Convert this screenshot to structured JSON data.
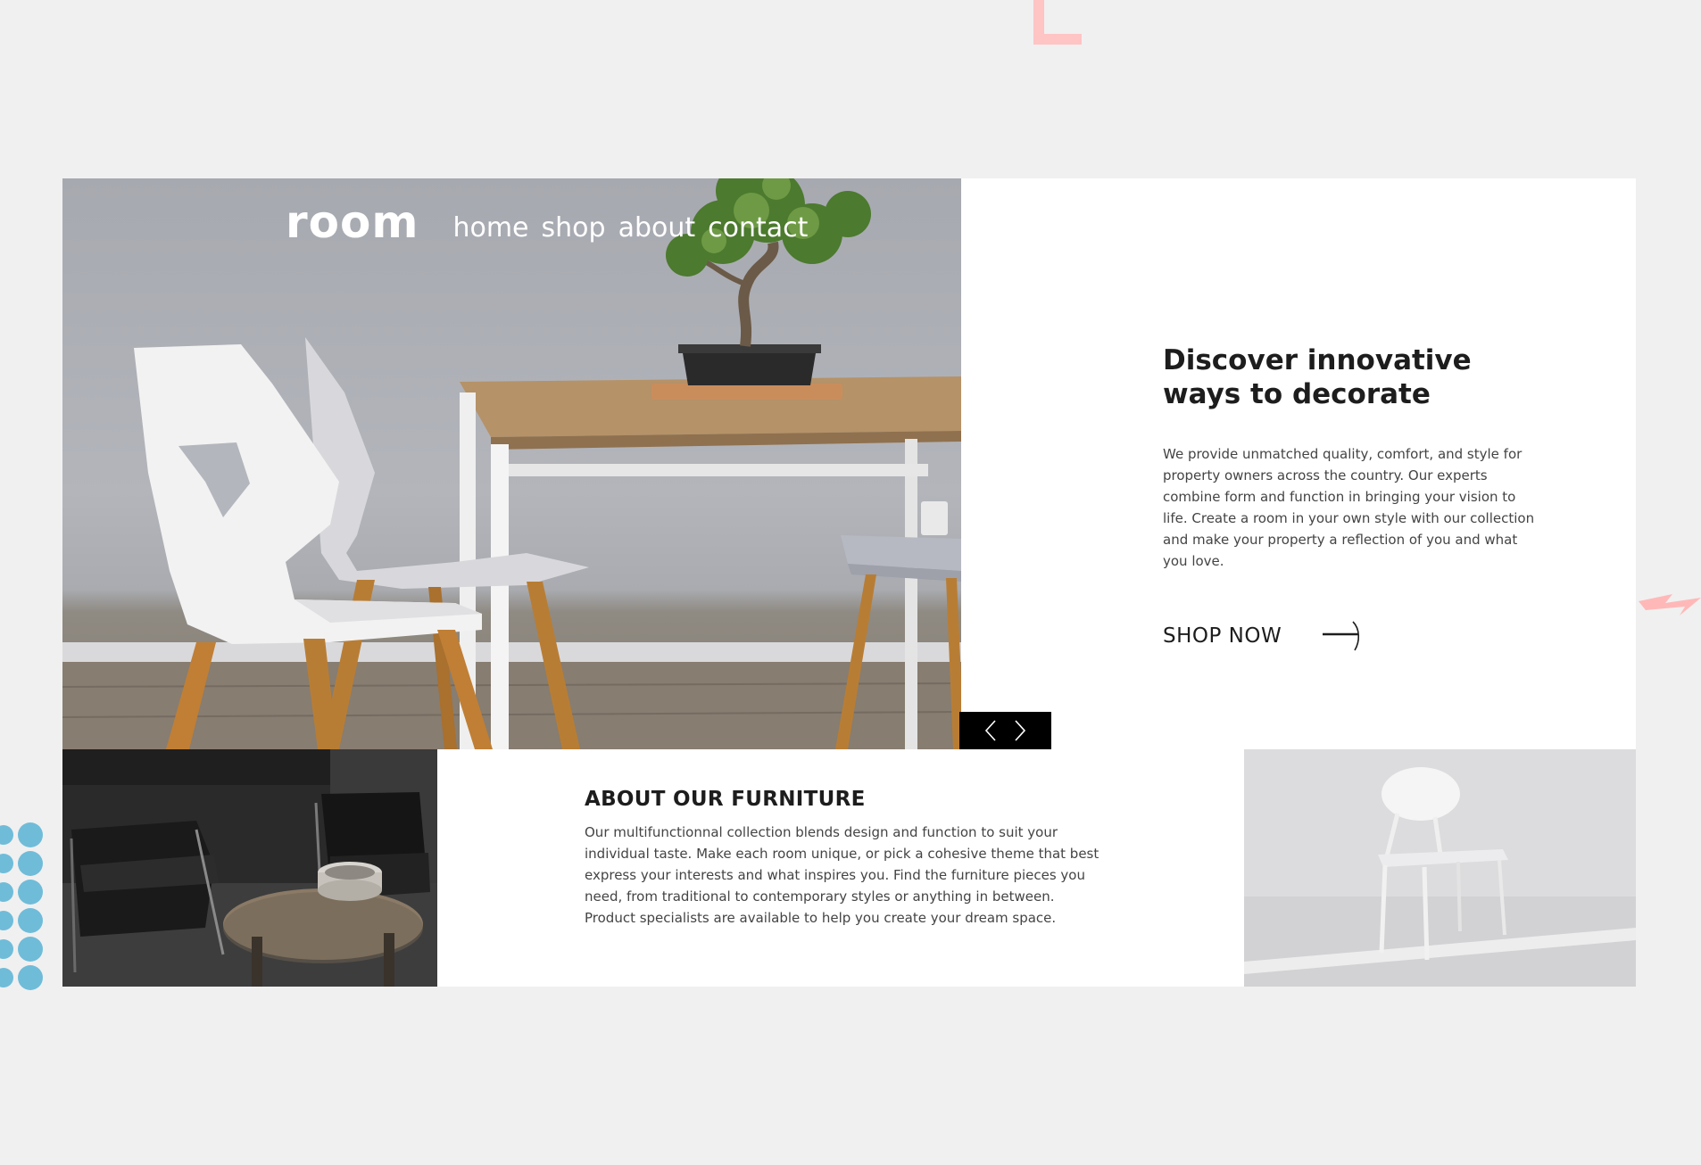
{
  "brand": {
    "logo": "room"
  },
  "nav": {
    "items": [
      {
        "label": "home"
      },
      {
        "label": "shop"
      },
      {
        "label": "about"
      },
      {
        "label": "contact"
      }
    ]
  },
  "hero": {
    "prev_icon": "chevron-left-icon",
    "next_icon": "chevron-right-icon"
  },
  "intro": {
    "heading": "Discover innovative ways to decorate",
    "body": "We provide unmatched quality, comfort, and style for property owners across the country. Our experts combine form and function in bringing your vision to life. Create a room in your own style with our collection and make your property a reflection of you and what you love.",
    "cta_label": "SHOP NOW",
    "cta_icon": "arrow-right-icon"
  },
  "about": {
    "heading": "ABOUT OUR FURNITURE",
    "body": "Our multifunctionnal collection blends design and function to suit your individual taste. Make each room unique, or pick a cohesive theme that best express your interests and what inspires you. Find the furniture pieces you need, from traditional to contemporary styles or anything in between. Product specialists are available to help you create your dream space."
  },
  "colors": {
    "background": "#f0f0f0",
    "panel": "#ffffff",
    "accent_pink": "#ffc4c4",
    "accent_blue": "#6fbcd9",
    "text_dark": "#1d1d1d"
  }
}
